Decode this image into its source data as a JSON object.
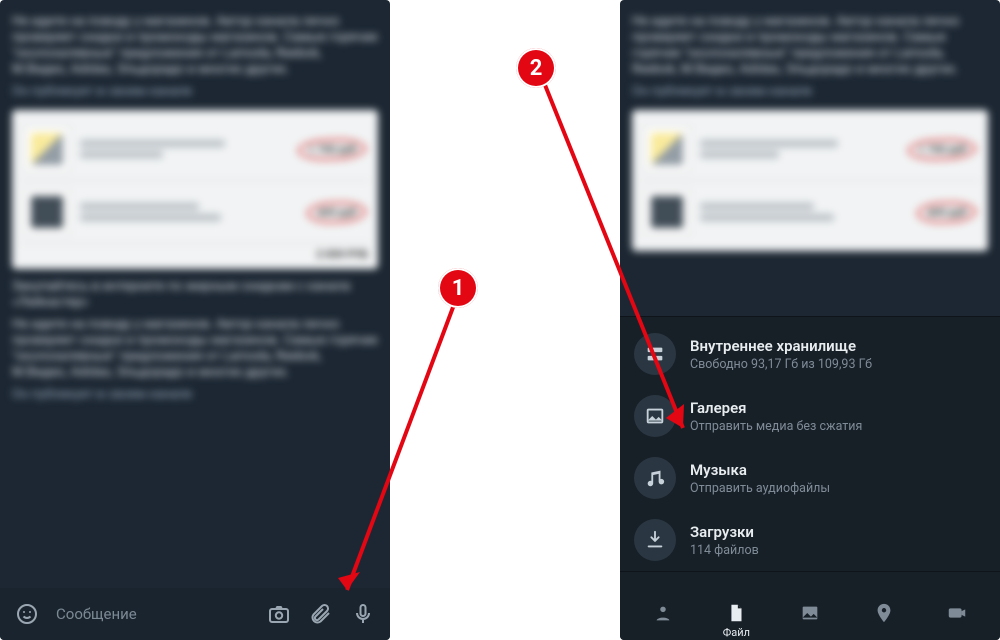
{
  "markers": {
    "one": "1",
    "two": "2"
  },
  "input": {
    "placeholder": "Сообщение"
  },
  "sheet": {
    "storage": {
      "title": "Внутреннее хранилище",
      "sub": "Свободно 93,17 Гб из 109,93 Гб"
    },
    "gallery": {
      "title": "Галерея",
      "sub": "Отправить медиа без сжатия"
    },
    "music": {
      "title": "Музыка",
      "sub": "Отправить аудиофайлы"
    },
    "downloads": {
      "title": "Загрузки",
      "sub": "114 файлов"
    }
  },
  "tabs": {
    "file": "Файл"
  },
  "chat": {
    "line1": "Не идите на поводу у магазинов. Автор канала лично проверяет скидки и промокоды магазинов. Самые горячие \"околохалявные\" предложения от Lamoda, Reebok, М.Видео, Adidas, Эльдорадо и многих других.",
    "line2": "Он публикует в своем канале",
    "line3": "Закупайтесь в интернете по жирным скидкам с канала «Лейкастер»",
    "price1": "1 790 руб",
    "price2": "499 руб",
    "footer": "2 059 РУБ"
  }
}
